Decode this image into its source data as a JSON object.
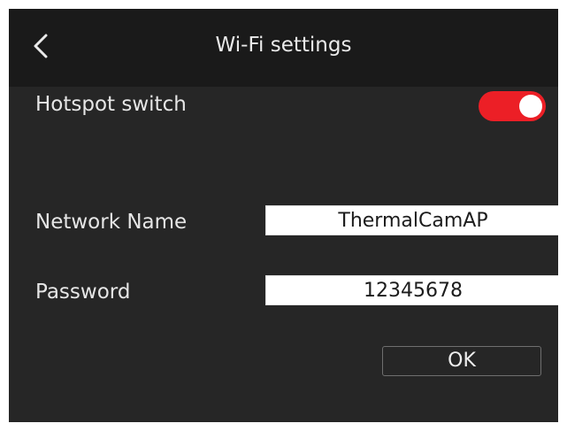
{
  "header": {
    "title": "Wi-Fi settings",
    "back_icon": "chevron-left-icon"
  },
  "hotspot": {
    "label": "Hotspot switch",
    "enabled": true,
    "toggle_color": "#ec1f26"
  },
  "network": {
    "name_label": "Network Name",
    "name_value": "ThermalCamAP",
    "password_label": "Password",
    "password_value": "12345678"
  },
  "actions": {
    "ok_label": "OK"
  }
}
